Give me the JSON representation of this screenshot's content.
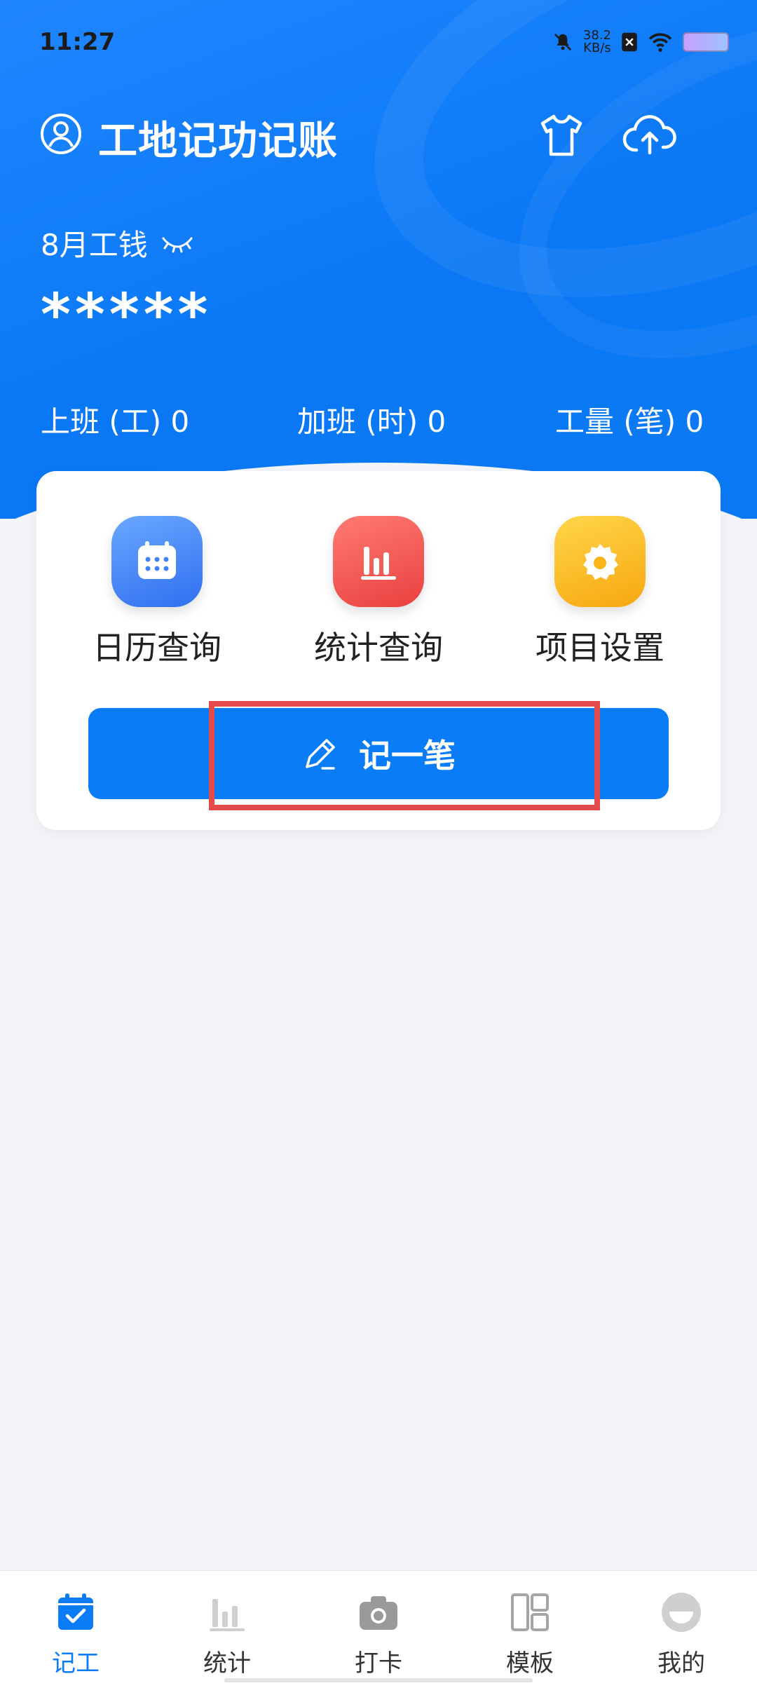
{
  "status": {
    "time": "11:27",
    "speed_value": "38.2",
    "speed_unit": "KB/s"
  },
  "header": {
    "title": "工地记功记账",
    "wage_label": "8月工钱",
    "wage_value": "*****"
  },
  "stats": [
    {
      "label": "上班 (工) 0"
    },
    {
      "label": "加班 (时) 0"
    },
    {
      "label": "工量 (笔) 0"
    }
  ],
  "features": [
    {
      "label": "日历查询",
      "icon": "calendar-icon",
      "color": "#3f84f6"
    },
    {
      "label": "统计查询",
      "icon": "bar-chart-icon",
      "color": "#f1514f"
    },
    {
      "label": "项目设置",
      "icon": "gear-icon",
      "color": "#f9b616"
    }
  ],
  "record_button": {
    "label": "记一笔"
  },
  "tabs": [
    {
      "label": "记工",
      "active": true
    },
    {
      "label": "统计"
    },
    {
      "label": "打卡"
    },
    {
      "label": "模板"
    },
    {
      "label": "我的"
    }
  ],
  "colors": {
    "primary": "#0a7cf7",
    "highlight": "#e54b4b"
  }
}
